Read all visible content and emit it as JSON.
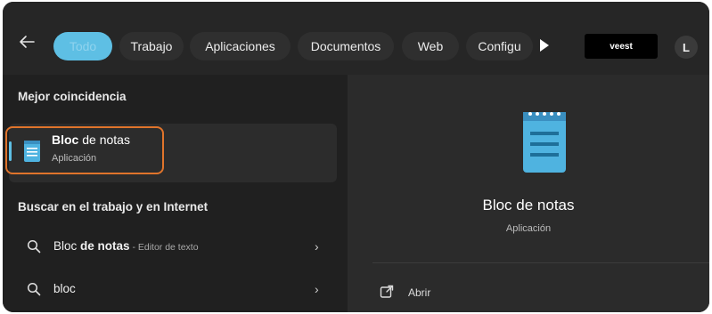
{
  "tabs": [
    {
      "label": "Todo",
      "active": true
    },
    {
      "label": "Trabajo"
    },
    {
      "label": "Aplicaciones"
    },
    {
      "label": "Documentos"
    },
    {
      "label": "Web"
    },
    {
      "label": "Configu"
    }
  ],
  "account": {
    "label": "veest"
  },
  "avatar": {
    "initial": "L"
  },
  "left": {
    "best_match_title": "Mejor coincidencia",
    "best_match": {
      "name_bold": "Bloc",
      "name_rest": " de notas",
      "type": "Aplicación"
    },
    "web_title": "Buscar en el trabajo y en Internet",
    "suggestions": [
      {
        "prefix": "Bloc ",
        "bold": "de notas",
        "desc": " - Editor de texto"
      },
      {
        "prefix": "bloc",
        "bold": "",
        "desc": ""
      }
    ]
  },
  "right": {
    "app_name": "Bloc de notas",
    "app_type": "Aplicación",
    "actions": [
      {
        "label": "Abrir",
        "icon": "open-icon"
      }
    ]
  },
  "colors": {
    "accent": "#5ebfe4",
    "highlight": "#e0742b",
    "background": "#202020",
    "panel": "#2b2b2b"
  }
}
